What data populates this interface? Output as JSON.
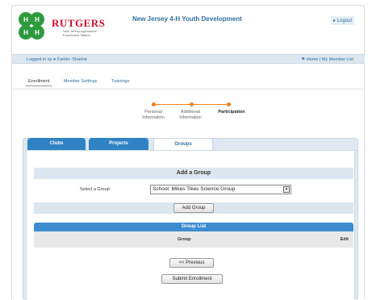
{
  "header": {
    "org_name": "RUTGERS",
    "org_subtitle": "New Jersey Agricultural Experiment Station",
    "app_title": "New Jersey 4-H Youth Development",
    "logout_label": "▸ Logout"
  },
  "info_bar": {
    "logged_in_prefix": "Logged in as",
    "user_label": "Farkle: Sharkie",
    "home_link": "Home",
    "separator": "|",
    "member_list_link": "My Member List"
  },
  "subnav": {
    "items": [
      {
        "label": "Enrollment",
        "active": true
      },
      {
        "label": "Member Settings",
        "active": false
      },
      {
        "label": "Trainings",
        "active": false
      }
    ]
  },
  "stepper": {
    "steps": [
      {
        "line1": "Personal",
        "line2": "Information",
        "current": false
      },
      {
        "line1": "Additional",
        "line2": "Information",
        "current": false
      },
      {
        "line1": "Participation",
        "line2": "",
        "current": true
      }
    ],
    "accent": "#f08020"
  },
  "tabs": [
    {
      "label": "Clubs",
      "selected": false
    },
    {
      "label": "Projects",
      "selected": false
    },
    {
      "label": "Groups",
      "selected": true
    }
  ],
  "add_group": {
    "heading": "Add a Group",
    "select_label": "Select a Group:",
    "selected_value": "School: Mikes Tikes Science Group",
    "add_button": "Add Group"
  },
  "group_list": {
    "heading": "Group List",
    "columns": [
      "Group",
      "Edit"
    ]
  },
  "footer_buttons": {
    "previous": "<< Previous",
    "submit": "Submit Enrollment"
  },
  "colors": {
    "brand_blue": "#2f6fa0",
    "tab_blue": "#2f83c5",
    "rutgers_red": "#c8102e",
    "clover_green": "#2e9a3e"
  }
}
